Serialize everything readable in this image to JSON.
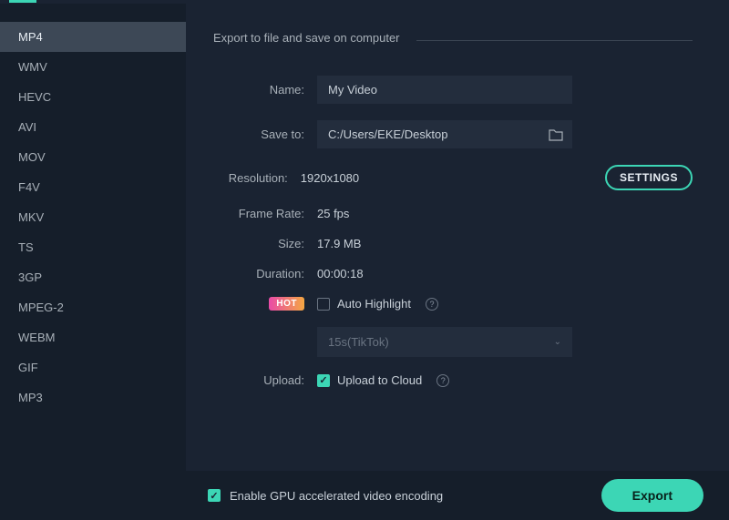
{
  "sidebar": {
    "items": [
      {
        "label": "MP4",
        "active": true
      },
      {
        "label": "WMV"
      },
      {
        "label": "HEVC"
      },
      {
        "label": "AVI"
      },
      {
        "label": "MOV"
      },
      {
        "label": "F4V"
      },
      {
        "label": "MKV"
      },
      {
        "label": "TS"
      },
      {
        "label": "3GP"
      },
      {
        "label": "MPEG-2"
      },
      {
        "label": "WEBM"
      },
      {
        "label": "GIF"
      },
      {
        "label": "MP3"
      }
    ]
  },
  "main": {
    "section_title": "Export to file and save on computer",
    "name_label": "Name:",
    "name_value": "My Video",
    "save_label": "Save to:",
    "save_value": "C:/Users/EKE/Desktop",
    "resolution_label": "Resolution:",
    "resolution_value": "1920x1080",
    "settings_label": "SETTINGS",
    "framerate_label": "Frame Rate:",
    "framerate_value": "25 fps",
    "size_label": "Size:",
    "size_value": "17.9 MB",
    "duration_label": "Duration:",
    "duration_value": "00:00:18",
    "hot_label": "HOT",
    "auto_highlight_label": "Auto Highlight",
    "auto_highlight_select": "15s(TikTok)",
    "upload_label": "Upload:",
    "upload_to_cloud_label": "Upload to Cloud"
  },
  "footer": {
    "gpu_label": "Enable GPU accelerated video encoding",
    "export_label": "Export"
  }
}
